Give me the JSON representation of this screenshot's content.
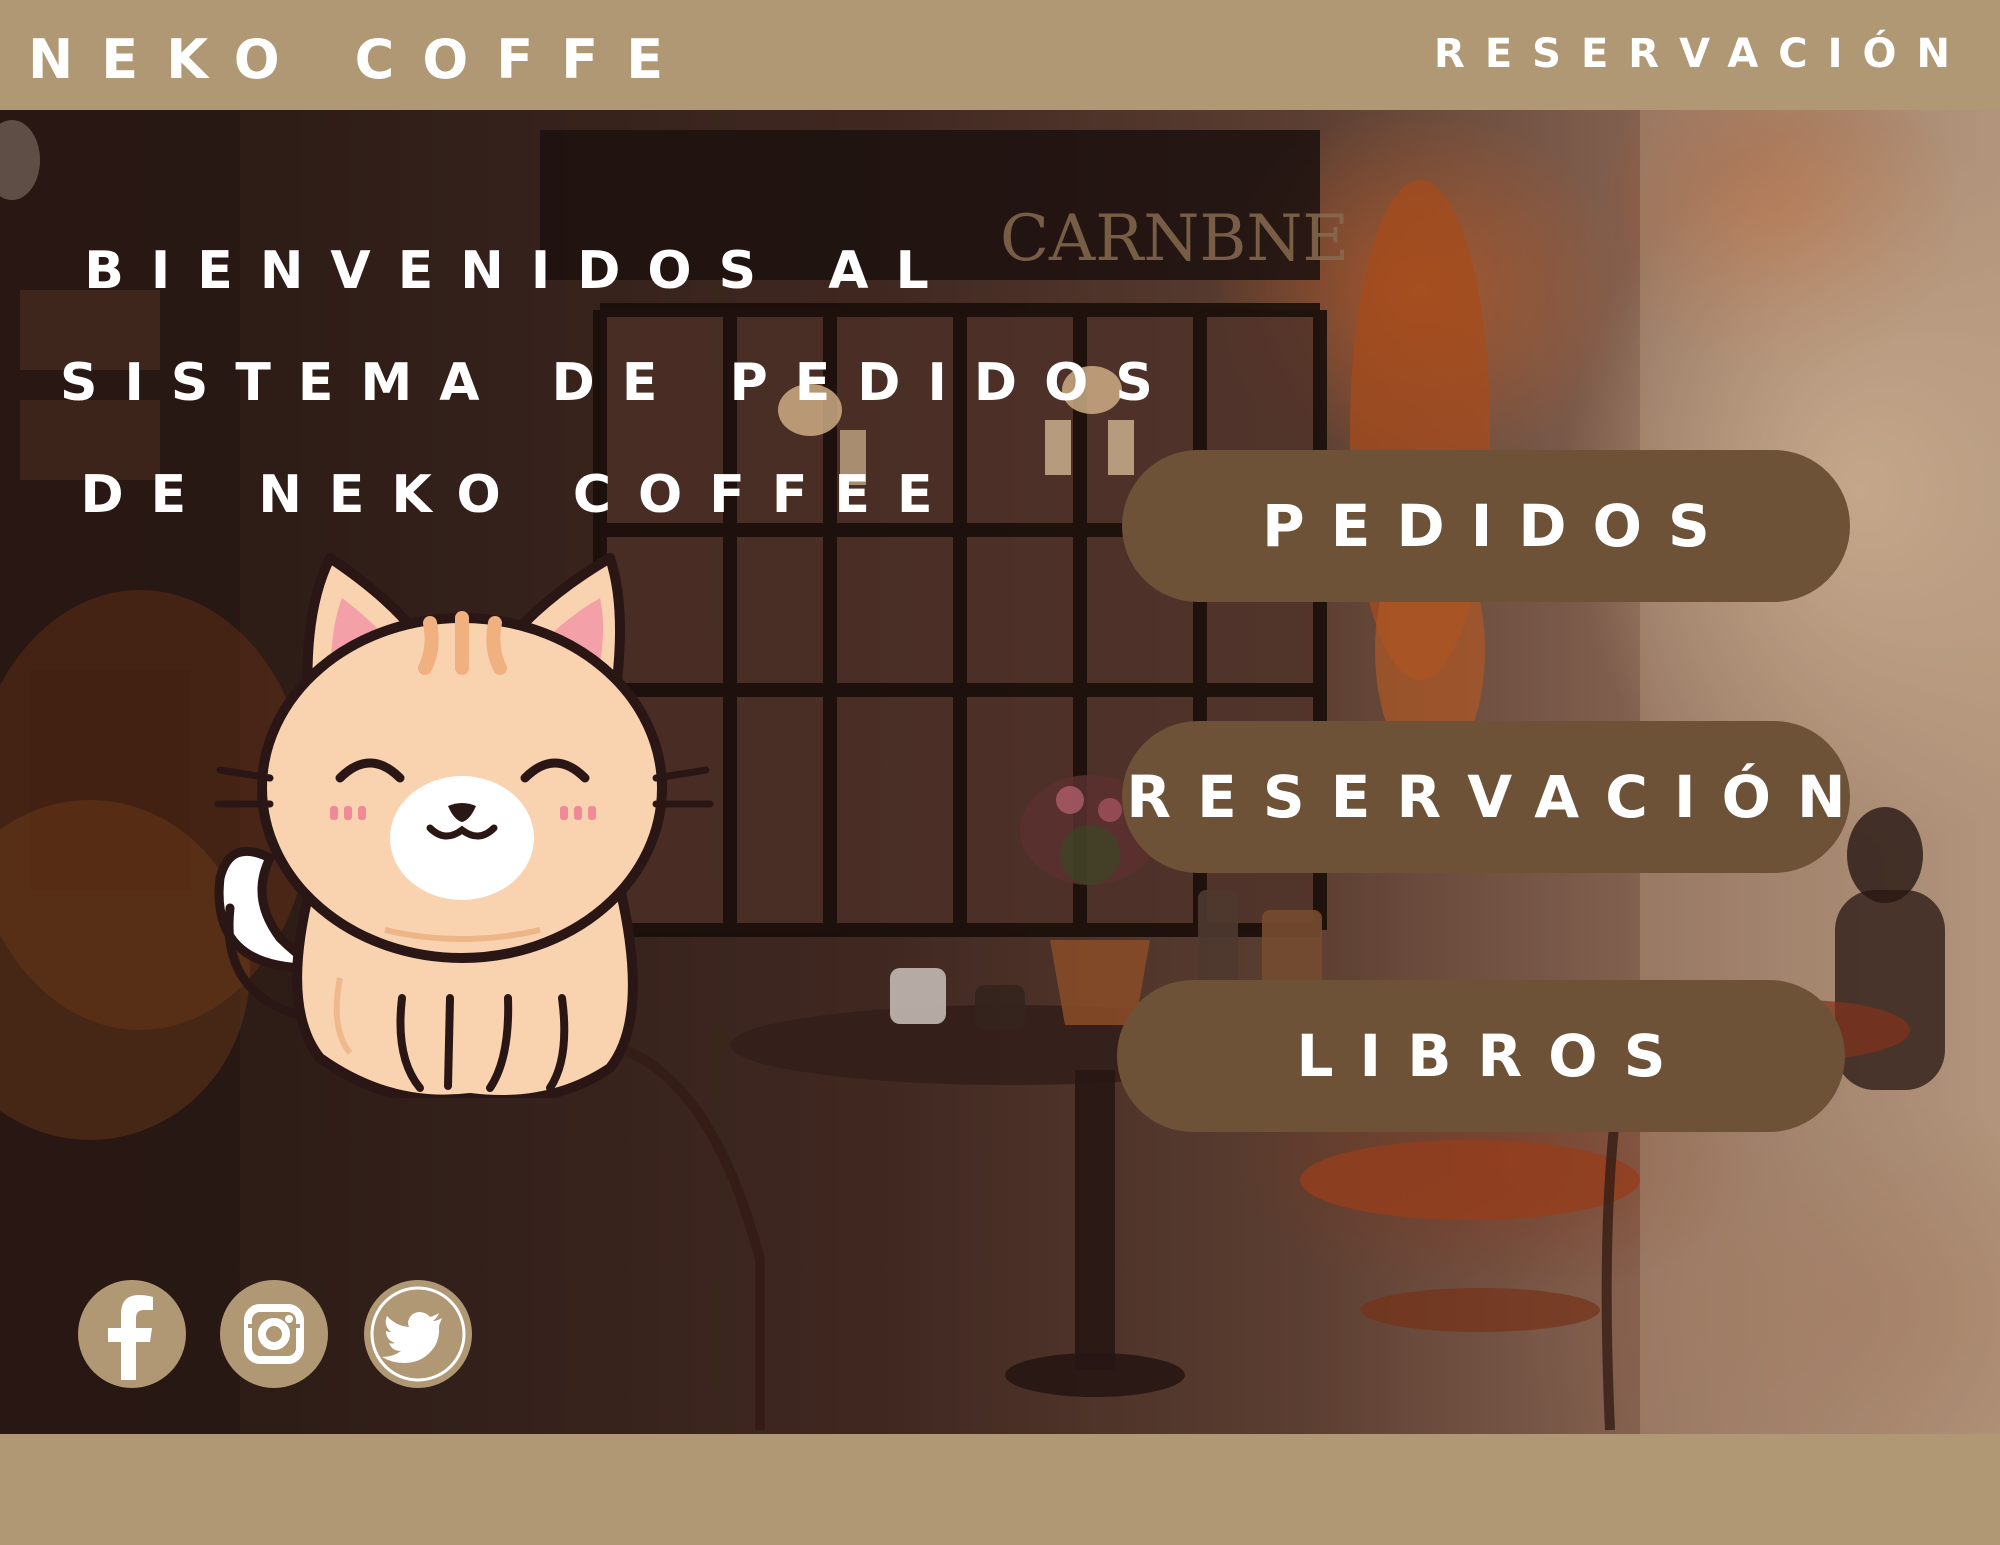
{
  "header": {
    "brand": "NEKO COFFE",
    "nav_reservation": "RESERVACIÓN"
  },
  "hero": {
    "welcome_lines": [
      "BIENVENIDOS AL",
      "SISTEMA DE PEDIDOS",
      "DE NEKO COFFEE"
    ],
    "background_sign": "CARNBNE"
  },
  "menu": {
    "pedidos": "PEDIDOS",
    "reservacion": "RESERVACIÓN",
    "libros": "LIBROS"
  },
  "socials": {
    "icons": [
      "facebook-icon",
      "instagram-icon",
      "twitter-icon"
    ]
  },
  "colors": {
    "bar": "#b09874",
    "button": "#6d5237",
    "text": "#ffffff"
  }
}
